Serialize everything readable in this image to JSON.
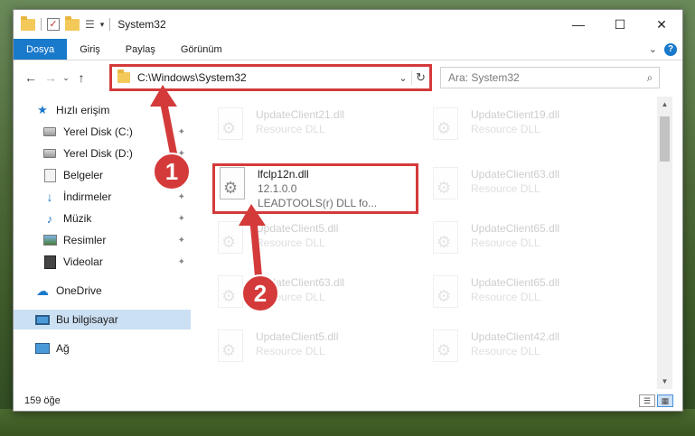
{
  "window": {
    "title": "System32",
    "minimize_glyph": "—",
    "maximize_glyph": "☐",
    "close_glyph": "✕"
  },
  "ribbon": {
    "tabs": [
      {
        "label": "Dosya"
      },
      {
        "label": "Giriş"
      },
      {
        "label": "Paylaş"
      },
      {
        "label": "Görünüm"
      }
    ],
    "expand_glyph": "⌄",
    "help_glyph": "?"
  },
  "nav": {
    "back_glyph": "←",
    "forward_glyph": "→",
    "recent_glyph": "⌄",
    "up_glyph": "↑",
    "address": "C:\\Windows\\System32",
    "address_drop_glyph": "⌄",
    "refresh_glyph": "↻",
    "search_placeholder": "Ara: System32",
    "search_icon_glyph": "⌕"
  },
  "sidebar": {
    "items": [
      {
        "label": "Hızlı erişim",
        "icon": "star-icon"
      },
      {
        "label": "Yerel Disk (C:)",
        "icon": "disk-icon",
        "pinned": true
      },
      {
        "label": "Yerel Disk (D:)",
        "icon": "disk-icon",
        "pinned": true
      },
      {
        "label": "Belgeler",
        "icon": "documents-icon",
        "pinned": true
      },
      {
        "label": "İndirmeler",
        "icon": "download-icon",
        "pinned": true
      },
      {
        "label": "Müzik",
        "icon": "music-icon",
        "pinned": true
      },
      {
        "label": "Resimler",
        "icon": "pictures-icon",
        "pinned": true
      },
      {
        "label": "Videolar",
        "icon": "videos-icon",
        "pinned": true
      },
      {
        "label": "OneDrive",
        "icon": "cloud-icon"
      },
      {
        "label": "Bu bilgisayar",
        "icon": "computer-icon",
        "selected": true
      },
      {
        "label": "Ağ",
        "icon": "network-icon"
      }
    ],
    "pin_glyph": "📌"
  },
  "files": [
    {
      "name": "UpdateClient21.dll",
      "type": "Resource DLL",
      "faded": true
    },
    {
      "name": "UpdateClient19.dll",
      "type": "Resource DLL",
      "faded": true
    },
    {
      "name": "lfclp12n.dll",
      "version": "12.1.0.0",
      "desc": "LEADTOOLS(r) DLL fo...",
      "faded": false
    },
    {
      "name": "UpdateClient63.dll",
      "type": "Resource DLL",
      "faded": true
    },
    {
      "name": "UpdateClient5.dll",
      "type": "Resource DLL",
      "faded": true
    },
    {
      "name": "UpdateClient65.dll",
      "type": "Resource DLL",
      "faded": true
    },
    {
      "name": "UpdateClient63.dll",
      "type": "Resource DLL",
      "faded": true
    },
    {
      "name": "UpdateClient65.dll",
      "type": "Resource DLL",
      "faded": true
    },
    {
      "name": "UpdateClient5.dll",
      "type": "Resource DLL",
      "faded": true
    },
    {
      "name": "UpdateClient42.dll",
      "type": "Resource DLL",
      "faded": true
    }
  ],
  "status": {
    "item_count": "159 öğe"
  },
  "annotations": {
    "step1": "1",
    "step2": "2",
    "highlight_color": "#d43a3a"
  },
  "colors": {
    "accent": "#1979ca",
    "selection": "#cce0f3"
  }
}
